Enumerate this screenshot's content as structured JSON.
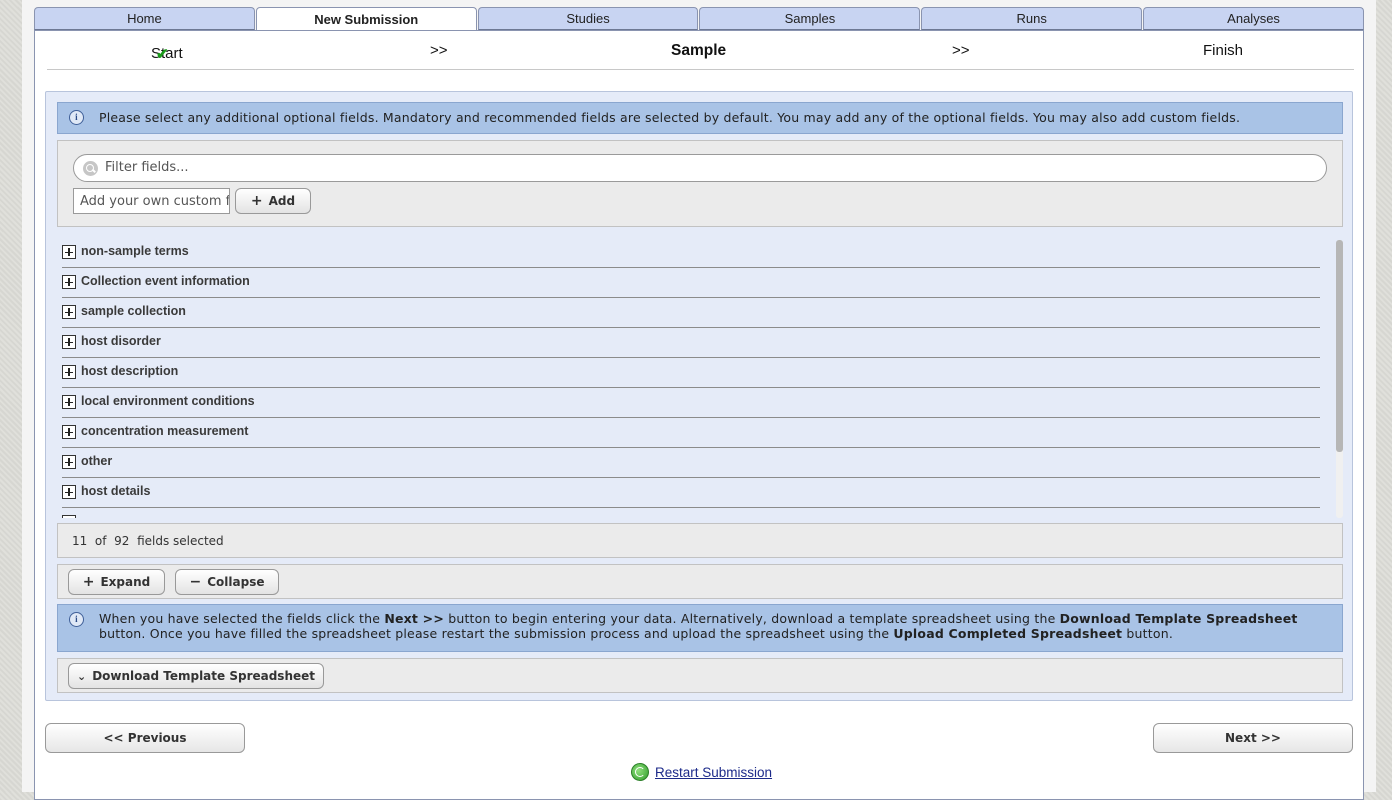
{
  "tabs": [
    {
      "label": "Home",
      "active": false
    },
    {
      "label": "New Submission",
      "active": true
    },
    {
      "label": "Studies",
      "active": false
    },
    {
      "label": "Samples",
      "active": false
    },
    {
      "label": "Runs",
      "active": false
    },
    {
      "label": "Analyses",
      "active": false
    }
  ],
  "steps": {
    "start": "Start",
    "sep1": ">>",
    "current": "Sample",
    "sep2": ">>",
    "finish": "Finish",
    "start_done_icon": "check-icon",
    "check_color": "#1a9a1a"
  },
  "info_top": "Please select any additional optional fields. Mandatory and recommended fields are selected by default. You may add any of the optional fields. You may also add custom fields.",
  "filter": {
    "placeholder": "Filter fields..."
  },
  "custom_field": {
    "placeholder": "Add your own custom fi",
    "add_label": "Add"
  },
  "groups": [
    "non-sample terms",
    "Collection event information",
    "sample collection",
    "host disorder",
    "host description",
    "local environment conditions",
    "concentration measurement",
    "other",
    "host details"
  ],
  "selection": {
    "selected": "11",
    "of": "of",
    "total": "92",
    "suffix": "fields selected"
  },
  "expand_label": "Expand",
  "collapse_label": "Collapse",
  "info_bottom": {
    "p1": "When you have selected the fields click the ",
    "b1": "Next >>",
    "p2": " button to begin entering your data. Alternatively, download a template spreadsheet using the ",
    "b2": "Download Template Spreadsheet",
    "p3": " button. Once you have filled the spreadsheet please restart the submission process and upload the spreadsheet using the ",
    "b3": "Upload Completed Spreadsheet",
    "p4": " button."
  },
  "download_label": "Download Template Spreadsheet",
  "previous_label": "<< Previous",
  "next_label": "Next >>",
  "restart_label": "Restart Submission",
  "colors": {
    "tab_bg": "#c8d4f2",
    "info_bg": "#a9c3e6",
    "panel_bg": "#e5ebf8",
    "link": "#1c2a8a"
  }
}
